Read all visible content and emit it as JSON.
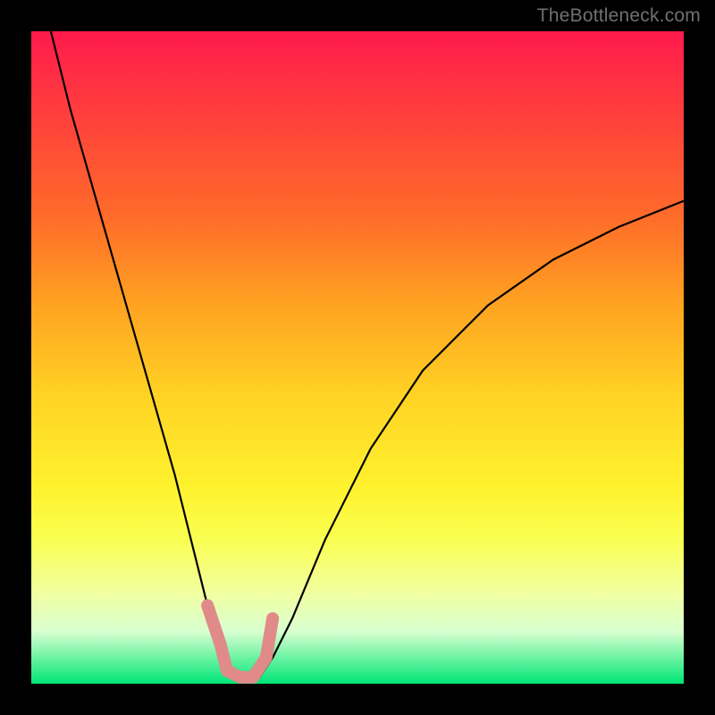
{
  "watermark": "TheBottleneck.com",
  "chart_data": {
    "type": "line",
    "title": "",
    "xlabel": "",
    "ylabel": "",
    "xlim": [
      0,
      100
    ],
    "ylim": [
      0,
      100
    ],
    "series": [
      {
        "name": "bottleneck-curve",
        "x": [
          3,
          6,
          10,
          14,
          18,
          22,
          25,
          27,
          29,
          30,
          31,
          33,
          35,
          37,
          40,
          45,
          52,
          60,
          70,
          80,
          90,
          100
        ],
        "y": [
          100,
          88,
          74,
          60,
          46,
          32,
          20,
          12,
          6,
          3,
          1,
          0.5,
          1,
          4,
          10,
          22,
          36,
          48,
          58,
          65,
          70,
          74
        ]
      }
    ],
    "highlight": {
      "name": "valley-marker",
      "x": [
        27,
        29,
        30,
        32,
        34,
        36,
        37
      ],
      "y": [
        12,
        6,
        2,
        1,
        1,
        4,
        10
      ],
      "color": "#e08a8a"
    },
    "colors": {
      "curve": "#000000",
      "marker": "#e08a8a",
      "gradient_top": "#ff1a4d",
      "gradient_bottom": "#00e676"
    }
  }
}
